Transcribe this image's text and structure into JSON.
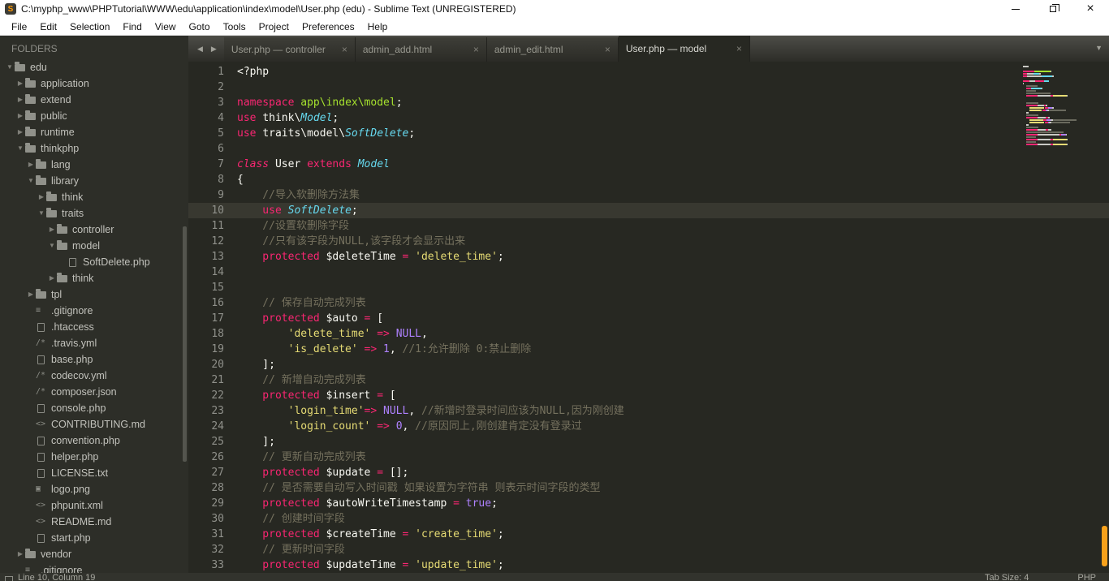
{
  "window": {
    "title": "C:\\myphp_www\\PHPTutorial\\WWW\\edu\\application\\index\\model\\User.php (edu) - Sublime Text (UNREGISTERED)"
  },
  "menu": {
    "items": [
      "File",
      "Edit",
      "Selection",
      "Find",
      "View",
      "Goto",
      "Tools",
      "Project",
      "Preferences",
      "Help"
    ]
  },
  "sidebar": {
    "header": "FOLDERS",
    "items": [
      {
        "label": "edu",
        "depth": 0,
        "kind": "folder",
        "state": "open"
      },
      {
        "label": "application",
        "depth": 1,
        "kind": "folder",
        "state": "closed"
      },
      {
        "label": "extend",
        "depth": 1,
        "kind": "folder",
        "state": "closed"
      },
      {
        "label": "public",
        "depth": 1,
        "kind": "folder",
        "state": "closed"
      },
      {
        "label": "runtime",
        "depth": 1,
        "kind": "folder",
        "state": "closed"
      },
      {
        "label": "thinkphp",
        "depth": 1,
        "kind": "folder",
        "state": "open"
      },
      {
        "label": "lang",
        "depth": 2,
        "kind": "folder",
        "state": "closed"
      },
      {
        "label": "library",
        "depth": 2,
        "kind": "folder",
        "state": "open"
      },
      {
        "label": "think",
        "depth": 3,
        "kind": "folder",
        "state": "closed"
      },
      {
        "label": "traits",
        "depth": 3,
        "kind": "folder",
        "state": "open"
      },
      {
        "label": "controller",
        "depth": 4,
        "kind": "folder",
        "state": "closed"
      },
      {
        "label": "model",
        "depth": 4,
        "kind": "folder",
        "state": "open"
      },
      {
        "label": "SoftDelete.php",
        "depth": 5,
        "kind": "file",
        "icon": "file"
      },
      {
        "label": "think",
        "depth": 4,
        "kind": "folder",
        "state": "closed"
      },
      {
        "label": "tpl",
        "depth": 2,
        "kind": "folder",
        "state": "closed"
      },
      {
        "label": ".gitignore",
        "depth": 2,
        "kind": "file",
        "icon": "list"
      },
      {
        "label": ".htaccess",
        "depth": 2,
        "kind": "file",
        "icon": "file"
      },
      {
        "label": ".travis.yml",
        "depth": 2,
        "kind": "file",
        "icon": "code2"
      },
      {
        "label": "base.php",
        "depth": 2,
        "kind": "file",
        "icon": "file"
      },
      {
        "label": "codecov.yml",
        "depth": 2,
        "kind": "file",
        "icon": "code2"
      },
      {
        "label": "composer.json",
        "depth": 2,
        "kind": "file",
        "icon": "code2"
      },
      {
        "label": "console.php",
        "depth": 2,
        "kind": "file",
        "icon": "file"
      },
      {
        "label": "CONTRIBUTING.md",
        "depth": 2,
        "kind": "file",
        "icon": "markup"
      },
      {
        "label": "convention.php",
        "depth": 2,
        "kind": "file",
        "icon": "file"
      },
      {
        "label": "helper.php",
        "depth": 2,
        "kind": "file",
        "icon": "file"
      },
      {
        "label": "LICENSE.txt",
        "depth": 2,
        "kind": "file",
        "icon": "file"
      },
      {
        "label": "logo.png",
        "depth": 2,
        "kind": "file",
        "icon": "image"
      },
      {
        "label": "phpunit.xml",
        "depth": 2,
        "kind": "file",
        "icon": "markup"
      },
      {
        "label": "README.md",
        "depth": 2,
        "kind": "file",
        "icon": "markup"
      },
      {
        "label": "start.php",
        "depth": 2,
        "kind": "file",
        "icon": "file"
      },
      {
        "label": "vendor",
        "depth": 1,
        "kind": "folder",
        "state": "closed"
      },
      {
        "label": ".gitignore",
        "depth": 1,
        "kind": "file",
        "icon": "list"
      }
    ]
  },
  "tab_bar": {
    "close_glyph": "×",
    "tabs": [
      {
        "label": "User.php — controller",
        "active": false
      },
      {
        "label": "admin_add.html",
        "active": false
      },
      {
        "label": "admin_edit.html",
        "active": false
      },
      {
        "label": "User.php — model",
        "active": true
      }
    ]
  },
  "editor": {
    "active_line": 10,
    "lines": [
      {
        "n": 1,
        "tokens": [
          [
            "p",
            "<?php"
          ]
        ]
      },
      {
        "n": 2,
        "tokens": []
      },
      {
        "n": 3,
        "tokens": [
          [
            "k",
            "namespace "
          ],
          [
            "g",
            "app\\index\\model"
          ],
          [
            "p",
            ";"
          ]
        ]
      },
      {
        "n": 4,
        "tokens": [
          [
            "k",
            "use "
          ],
          [
            "p",
            "think\\"
          ],
          [
            "ti",
            "Model"
          ],
          [
            "p",
            ";"
          ]
        ]
      },
      {
        "n": 5,
        "tokens": [
          [
            "k",
            "use "
          ],
          [
            "p",
            "traits\\model\\"
          ],
          [
            "ti",
            "SoftDelete"
          ],
          [
            "p",
            ";"
          ]
        ]
      },
      {
        "n": 6,
        "tokens": []
      },
      {
        "n": 7,
        "tokens": [
          [
            "ki",
            "class "
          ],
          [
            "p",
            "User "
          ],
          [
            "k",
            "extends "
          ],
          [
            "ti",
            "Model"
          ]
        ]
      },
      {
        "n": 8,
        "tokens": [
          [
            "p",
            "{"
          ]
        ]
      },
      {
        "n": 9,
        "tokens": [
          [
            "c",
            "    //导入软删除方法集"
          ]
        ]
      },
      {
        "n": 10,
        "tokens": [
          [
            "k",
            "    use "
          ],
          [
            "ti",
            "SoftDelete"
          ],
          [
            "p",
            ";"
          ]
        ]
      },
      {
        "n": 11,
        "tokens": [
          [
            "c",
            "    //设置软删除字段"
          ]
        ]
      },
      {
        "n": 12,
        "tokens": [
          [
            "c",
            "    //只有该字段为NULL,该字段才会显示出来"
          ]
        ]
      },
      {
        "n": 13,
        "tokens": [
          [
            "k",
            "    protected "
          ],
          [
            "p",
            "$deleteTime "
          ],
          [
            "k",
            "= "
          ],
          [
            "s",
            "'delete_time'"
          ],
          [
            "p",
            ";"
          ]
        ]
      },
      {
        "n": 14,
        "tokens": []
      },
      {
        "n": 15,
        "tokens": []
      },
      {
        "n": 16,
        "tokens": [
          [
            "c",
            "    // 保存自动完成列表"
          ]
        ]
      },
      {
        "n": 17,
        "tokens": [
          [
            "k",
            "    protected "
          ],
          [
            "p",
            "$auto "
          ],
          [
            "k",
            "= "
          ],
          [
            "p",
            "["
          ]
        ]
      },
      {
        "n": 18,
        "tokens": [
          [
            "s",
            "        'delete_time'"
          ],
          [
            "k",
            " => "
          ],
          [
            "n",
            "NULL"
          ],
          [
            "p",
            ","
          ]
        ]
      },
      {
        "n": 19,
        "tokens": [
          [
            "s",
            "        'is_delete'"
          ],
          [
            "k",
            " => "
          ],
          [
            "n",
            "1"
          ],
          [
            "p",
            ", "
          ],
          [
            "c",
            "//1:允许删除 0:禁止删除"
          ]
        ]
      },
      {
        "n": 20,
        "tokens": [
          [
            "p",
            "    ];"
          ]
        ]
      },
      {
        "n": 21,
        "tokens": [
          [
            "c",
            "    // 新增自动完成列表"
          ]
        ]
      },
      {
        "n": 22,
        "tokens": [
          [
            "k",
            "    protected "
          ],
          [
            "p",
            "$insert "
          ],
          [
            "k",
            "= "
          ],
          [
            "p",
            "["
          ]
        ]
      },
      {
        "n": 23,
        "tokens": [
          [
            "s",
            "        'login_time'"
          ],
          [
            "k",
            "=> "
          ],
          [
            "n",
            "NULL"
          ],
          [
            "p",
            ", "
          ],
          [
            "c",
            "//新增时登录时间应该为NULL,因为刚创建"
          ]
        ]
      },
      {
        "n": 24,
        "tokens": [
          [
            "s",
            "        'login_count'"
          ],
          [
            "k",
            " => "
          ],
          [
            "n",
            "0"
          ],
          [
            "p",
            ", "
          ],
          [
            "c",
            "//原因同上,刚创建肯定没有登录过"
          ]
        ]
      },
      {
        "n": 25,
        "tokens": [
          [
            "p",
            "    ];"
          ]
        ]
      },
      {
        "n": 26,
        "tokens": [
          [
            "c",
            "    // 更新自动完成列表"
          ]
        ]
      },
      {
        "n": 27,
        "tokens": [
          [
            "k",
            "    protected "
          ],
          [
            "p",
            "$update "
          ],
          [
            "k",
            "= "
          ],
          [
            "p",
            "[];"
          ]
        ]
      },
      {
        "n": 28,
        "tokens": [
          [
            "c",
            "    // 是否需要自动写入时间戳 如果设置为字符串 则表示时间字段的类型"
          ]
        ]
      },
      {
        "n": 29,
        "tokens": [
          [
            "k",
            "    protected "
          ],
          [
            "p",
            "$autoWriteTimestamp "
          ],
          [
            "k",
            "= "
          ],
          [
            "n",
            "true"
          ],
          [
            "p",
            ";"
          ]
        ]
      },
      {
        "n": 30,
        "tokens": [
          [
            "c",
            "    // 创建时间字段"
          ]
        ]
      },
      {
        "n": 31,
        "tokens": [
          [
            "k",
            "    protected "
          ],
          [
            "p",
            "$createTime "
          ],
          [
            "k",
            "= "
          ],
          [
            "s",
            "'create_time'"
          ],
          [
            "p",
            ";"
          ]
        ]
      },
      {
        "n": 32,
        "tokens": [
          [
            "c",
            "    // 更新时间字段"
          ]
        ]
      },
      {
        "n": 33,
        "tokens": [
          [
            "k",
            "    protected "
          ],
          [
            "p",
            "$updateTime "
          ],
          [
            "k",
            "= "
          ],
          [
            "s",
            "'update_time'"
          ],
          [
            "p",
            ";"
          ]
        ]
      }
    ]
  },
  "status_bar": {
    "position": "Line 10, Column 19",
    "tab_size": "Tab Size: 4",
    "syntax": "PHP"
  },
  "colors": {
    "editor_bg": "#272822",
    "sidebar_bg": "#2d2e28",
    "line_highlight": "#383830",
    "scrollbar_accent": "#f9a21b",
    "keyword": "#f92672",
    "type": "#66d9ef",
    "string": "#e6db74",
    "constant": "#ae81ff",
    "comment": "#75715e",
    "namespace_path": "#a6e22e"
  }
}
